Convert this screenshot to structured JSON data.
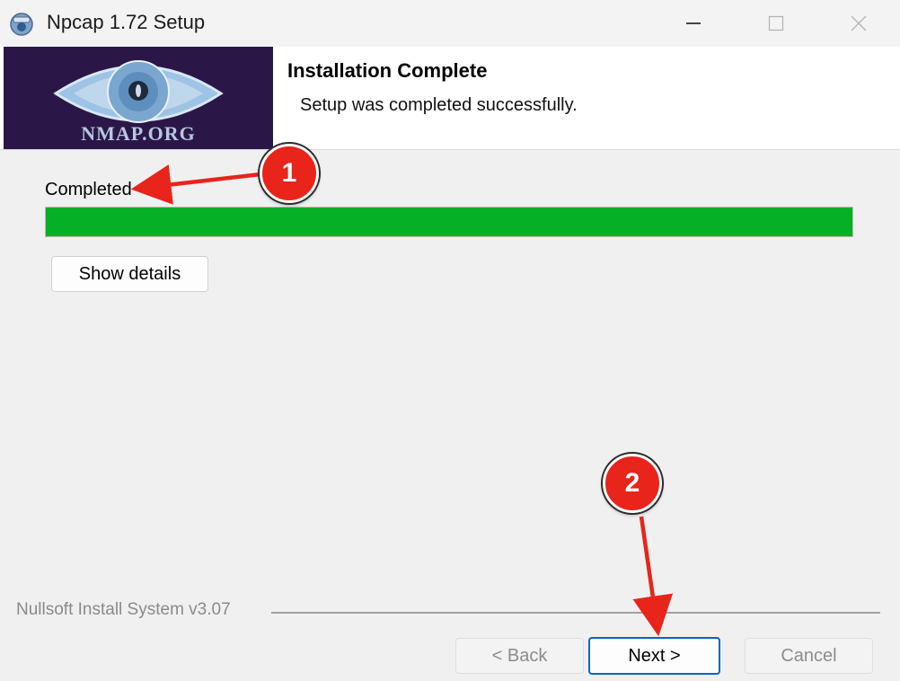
{
  "window": {
    "title": "Npcap 1.72 Setup",
    "icons": {
      "app": "npcap-app-icon",
      "minimize": "minimize-icon",
      "maximize": "maximize-icon",
      "close": "close-icon"
    }
  },
  "header": {
    "logo_text": "NMAP.ORG",
    "logo_icon": "eye-logo",
    "title": "Installation Complete",
    "subtitle": "Setup was completed successfully."
  },
  "content": {
    "status_label": "Completed",
    "progress_fraction": 1.0,
    "progress_color": "#06b025",
    "show_details_label": "Show details"
  },
  "footer": {
    "brand": "Nullsoft Install System v3.07",
    "back_label": "< Back",
    "next_label": "Next >",
    "cancel_label": "Cancel"
  },
  "annotations": {
    "step1": "1",
    "step2": "2",
    "badge_color": "#e8241b",
    "arrow_color": "#e8241b"
  }
}
